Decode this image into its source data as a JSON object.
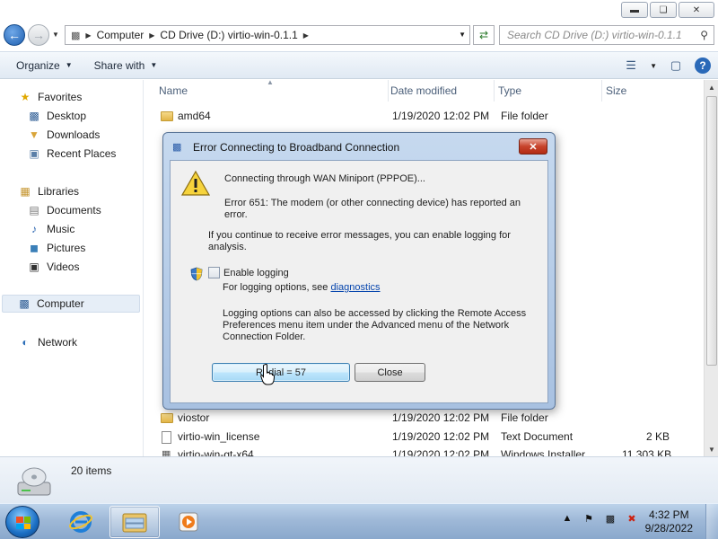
{
  "explorer": {
    "address": [
      "Computer",
      "CD Drive (D:) virtio-win-0.1.1"
    ],
    "search_placeholder": "Search CD Drive (D:) virtio-win-0.1.1",
    "toolbar": {
      "organize": "Organize",
      "share_with": "Share with"
    },
    "nav": {
      "favorites": "Favorites",
      "desktop": "Desktop",
      "downloads": "Downloads",
      "recent_places": "Recent Places",
      "libraries": "Libraries",
      "documents": "Documents",
      "music": "Music",
      "pictures": "Pictures",
      "videos": "Videos",
      "computer": "Computer",
      "network": "Network"
    },
    "columns": {
      "name": "Name",
      "date": "Date modified",
      "type": "Type",
      "size": "Size"
    },
    "files": [
      {
        "name": "amd64",
        "date": "1/19/2020 12:02 PM",
        "type": "File folder",
        "size": ""
      },
      {
        "name": "viostor",
        "date": "1/19/2020 12:02 PM",
        "type": "File folder",
        "size": ""
      },
      {
        "name": "virtio-win_license",
        "date": "1/19/2020 12:02 PM",
        "type": "Text Document",
        "size": "2 KB"
      },
      {
        "name": "virtio-win-gt-x64",
        "date": "1/19/2020 12:02 PM",
        "type": "Windows Installer",
        "size": "11,303 KB"
      }
    ],
    "status": "20 items"
  },
  "dialog": {
    "title": "Error Connecting to Broadband Connection",
    "connecting": "Connecting through WAN Miniport (PPPOE)...",
    "error_line1": "Error 651: The modem (or other connecting device) has reported an",
    "error_line2": "error.",
    "logging_hint1": "If you continue to receive error messages, you can enable logging for",
    "logging_hint2": "analysis.",
    "enable_logging": "Enable logging",
    "options_prefix": "For logging options, see",
    "diagnostics_link": "diagnostics",
    "access_line1": "Logging options can also be accessed by clicking the Remote Access",
    "access_line2": "Preferences menu item under the Advanced menu of the Network",
    "access_line3": "Connection Folder.",
    "redial_button": "Redial = 57",
    "close_button": "Close",
    "enable_logging_checked": false
  },
  "taskbar": {
    "time": "4:32 PM",
    "date": "9/28/2022"
  },
  "colors": {
    "dialog_frame": "#a8c1e1",
    "close_red": "#c7432b",
    "taskbar": "#9fb9d8"
  }
}
